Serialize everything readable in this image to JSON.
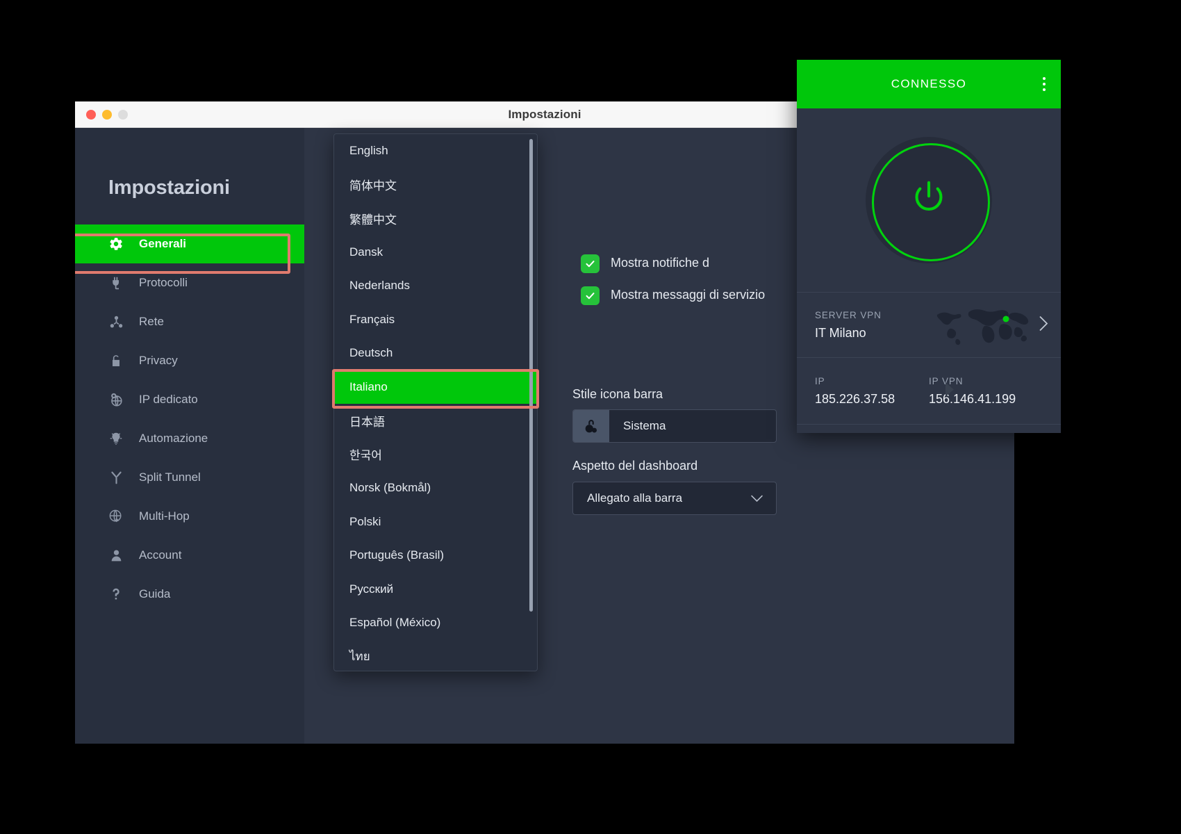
{
  "window": {
    "title": "Impostazioni",
    "traffic_lights": [
      "close",
      "minimize",
      "zoom"
    ]
  },
  "sidebar": {
    "title": "Impostazioni",
    "items": [
      {
        "label": "Generali",
        "icon": "gear-icon",
        "active": true
      },
      {
        "label": "Protocolli",
        "icon": "plug-icon",
        "active": false
      },
      {
        "label": "Rete",
        "icon": "network-icon",
        "active": false
      },
      {
        "label": "Privacy",
        "icon": "lock-icon",
        "active": false
      },
      {
        "label": "IP dedicato",
        "icon": "globe-pin-icon",
        "active": false
      },
      {
        "label": "Automazione",
        "icon": "lightbulb-icon",
        "active": false
      },
      {
        "label": "Split Tunnel",
        "icon": "split-icon",
        "active": false
      },
      {
        "label": "Multi-Hop",
        "icon": "globe-arrow-icon",
        "active": false
      },
      {
        "label": "Account",
        "icon": "person-icon",
        "active": false
      },
      {
        "label": "Guida",
        "icon": "question-icon",
        "active": false
      }
    ]
  },
  "content": {
    "checkboxes": [
      {
        "label": "Mostra notifiche d",
        "checked": true
      },
      {
        "label": "Mostra messaggi di servizio",
        "checked": true
      }
    ],
    "tray_icon_style": {
      "label": "Stile icona barra",
      "value": "Sistema",
      "icon": "lock-filled-icon"
    },
    "dashboard_appearance": {
      "label": "Aspetto del dashboard",
      "value": "Allegato alla barra",
      "icon": "chevron-down-icon"
    }
  },
  "language_dropdown": {
    "selected": "Italiano",
    "options": [
      "English",
      "简体中文",
      "繁體中文",
      "Dansk",
      "Nederlands",
      "Français",
      "Deutsch",
      "Italiano",
      "日本語",
      "한국어",
      "Norsk (Bokmål)",
      "Polski",
      "Português (Brasil)",
      "Русский",
      "Español (México)",
      "ไทย"
    ]
  },
  "vpn_widget": {
    "status": "CONNESSO",
    "menu_icon": "kebab-menu-icon",
    "power_icon": "power-icon",
    "server": {
      "label": "SERVER VPN",
      "value": "IT Milano",
      "chevron_icon": "chevron-right-icon",
      "map_icon": "world-map-icon"
    },
    "ip": {
      "label": "IP",
      "value": "185.226.37.58"
    },
    "ip_vpn": {
      "label": "IP VPN",
      "value": "156.146.41.199",
      "arrow_icon": "arrow-right-icon"
    },
    "expand_icon": "chevron-down-icon"
  },
  "colors": {
    "accent_green": "#00c70b",
    "highlight_red": "#e07b6e",
    "panel_bg": "#2e3545",
    "sidebar_bg": "#282f3e",
    "dropdown_bg": "#272e3d"
  }
}
